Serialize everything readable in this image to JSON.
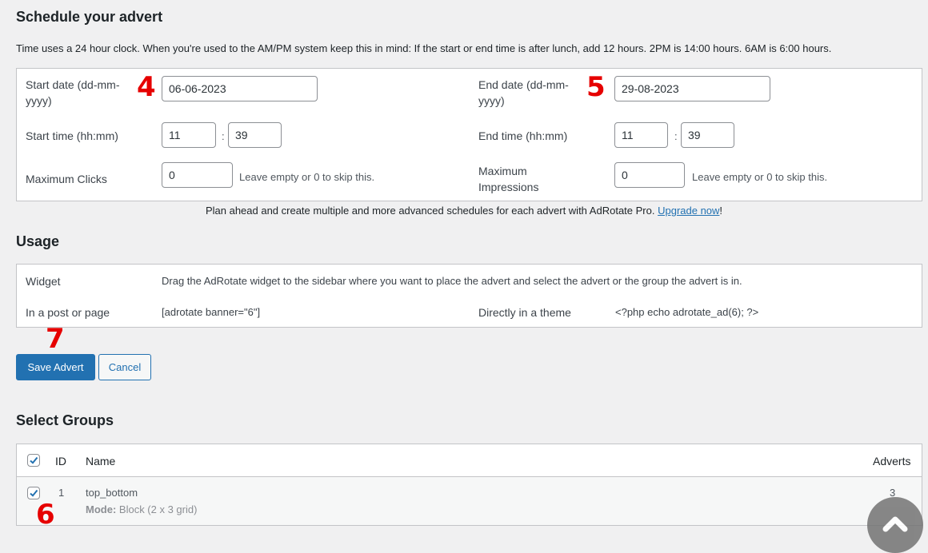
{
  "schedule": {
    "title": "Schedule your advert",
    "note": "Time uses a 24 hour clock. When you're used to the AM/PM system keep this in mind: If the start or end time is after lunch, add 12 hours. 2PM is 14:00 hours. 6AM is 6:00 hours.",
    "start_date_label": "Start date (dd-mm-yyyy)",
    "start_date_value": "06-06-2023",
    "end_date_label": "End date (dd-mm-yyyy)",
    "end_date_value": "29-08-2023",
    "start_time_label": "Start time (hh:mm)",
    "start_hour": "11",
    "start_minute": "39",
    "end_time_label": "End time (hh:mm)",
    "end_hour": "11",
    "end_minute": "39",
    "colon": ":",
    "max_clicks_label": "Maximum Clicks",
    "max_clicks_value": "0",
    "max_impressions_label": "Maximum Impressions",
    "max_impressions_value": "0",
    "skip_help": "Leave empty or 0 to skip this.",
    "promo_text": "Plan ahead and create multiple and more advanced schedules for each advert with AdRotate Pro.",
    "promo_link": "Upgrade now",
    "promo_end": "!"
  },
  "usage": {
    "title": "Usage",
    "widget_label": "Widget",
    "widget_text": "Drag the AdRotate widget to the sidebar where you want to place the advert and select the advert or the group the advert is in.",
    "post_label": "In a post or page",
    "post_code": "[adrotate banner=\"6\"]",
    "theme_label": "Directly in a theme",
    "theme_code": "<?php echo adrotate_ad(6); ?>"
  },
  "actions": {
    "save_label": "Save Advert",
    "cancel_label": "Cancel"
  },
  "groups": {
    "title": "Select Groups",
    "columns": {
      "id": "ID",
      "name": "Name",
      "adverts": "Adverts"
    },
    "rows": [
      {
        "id": "1",
        "name": "top_bottom",
        "mode_label": "Mode:",
        "mode_value": "Block (2 x 3 grid)",
        "adverts": "3",
        "checked": true
      }
    ]
  },
  "markers": {
    "m4": "4",
    "m5": "5",
    "m6": "6",
    "m7": "7"
  },
  "colors": {
    "primary": "#2271b1",
    "marker": "#e60000"
  }
}
